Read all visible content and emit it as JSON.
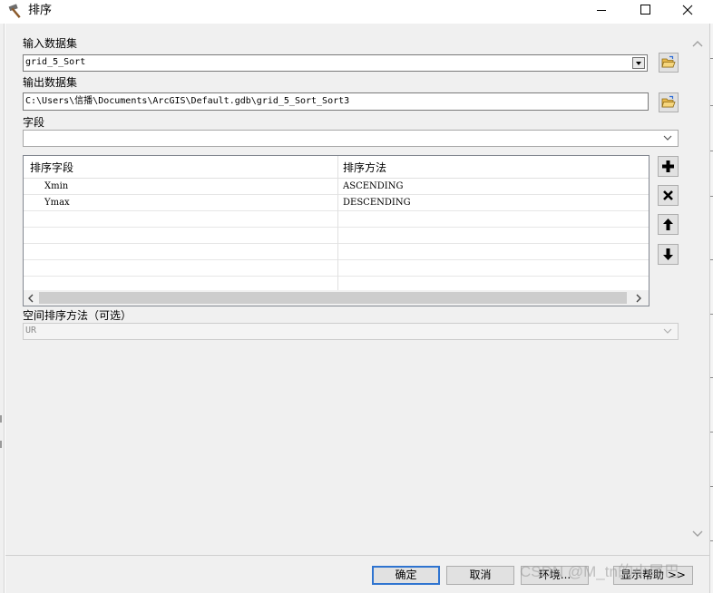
{
  "window": {
    "title": "排序"
  },
  "input_dataset": {
    "label": "输入数据集",
    "value": "grid_5_Sort"
  },
  "output_dataset": {
    "label": "输出数据集",
    "value": "C:\\Users\\信播\\Documents\\ArcGIS\\Default.gdb\\grid_5_Sort_Sort3"
  },
  "field": {
    "label": "字段",
    "value": ""
  },
  "sort_table": {
    "headers": [
      "排序字段",
      "排序方法"
    ],
    "rows": [
      {
        "field": "Xmin",
        "method": "ASCENDING"
      },
      {
        "field": "Ymax",
        "method": "DESCENDING"
      }
    ]
  },
  "spatial_sort": {
    "label": "空间排序方法（可选）",
    "value": "UR"
  },
  "buttons": {
    "ok": "确定",
    "cancel": "取消",
    "environments": "环境...",
    "show_help": "显示帮助 >>"
  },
  "watermark": {
    "text": "CSDN @M_tn的小尾巴"
  },
  "colors": {
    "dialog_bg": "#f0f0f0",
    "default_button_border": "#2f74d0",
    "folder_icon": "#e8b84a"
  }
}
